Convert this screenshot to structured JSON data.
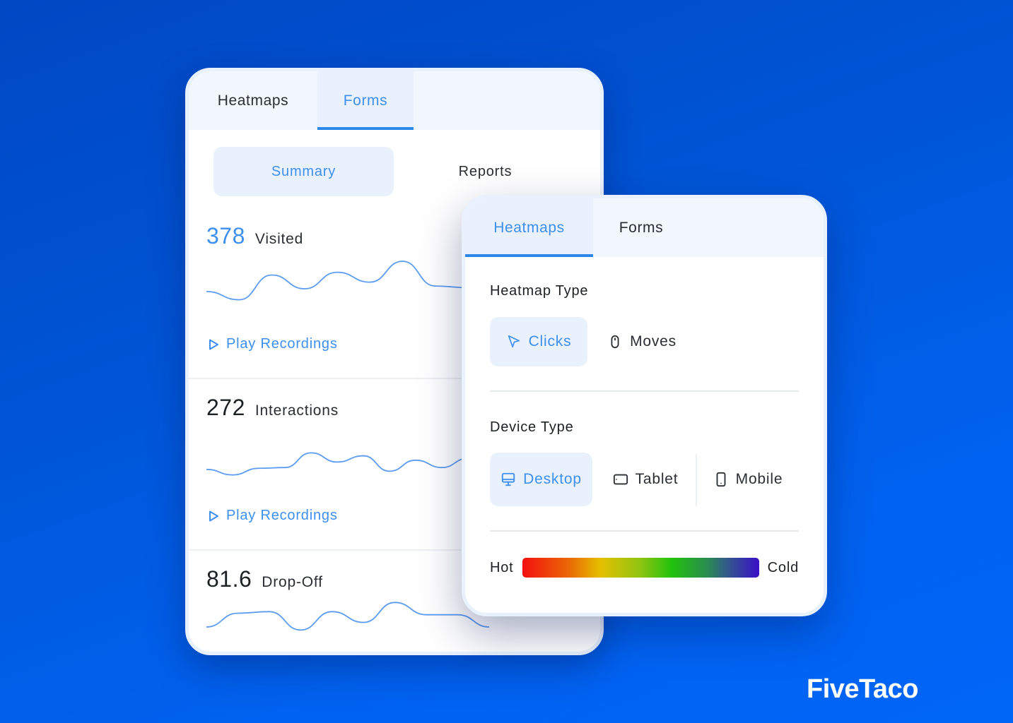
{
  "brand": {
    "logo_text": "FiveTaco"
  },
  "forms_panel": {
    "tabs": [
      {
        "label": "Heatmaps",
        "active": false
      },
      {
        "label": "Forms",
        "active": true
      }
    ],
    "segments": [
      {
        "label": "Summary",
        "active": true
      },
      {
        "label": "Reports",
        "active": false
      }
    ],
    "metrics": [
      {
        "value": "378",
        "label": "Visited",
        "accent": true,
        "action": "Play Recordings",
        "sparkline": [
          0.45,
          0.3,
          0.75,
          0.5,
          0.8,
          0.62,
          1.0,
          0.55,
          0.52
        ]
      },
      {
        "value": "272",
        "label": "Interactions",
        "accent": false,
        "action": "Play Recordings",
        "sparkline": [
          0.35,
          0.2,
          0.38,
          0.4,
          0.8,
          0.55,
          0.72,
          0.3,
          0.6,
          0.4,
          0.65
        ]
      },
      {
        "value": "81.6",
        "label": "Drop-Off",
        "accent": false,
        "action": "",
        "sparkline": [
          0.2,
          0.65,
          0.7,
          0.1,
          0.7,
          0.35,
          1.0,
          0.6,
          0.6,
          0.2
        ]
      }
    ]
  },
  "heatmap_panel": {
    "tabs": [
      {
        "label": "Heatmaps",
        "active": true
      },
      {
        "label": "Forms",
        "active": false
      }
    ],
    "heatmap_type": {
      "label": "Heatmap Type",
      "options": [
        {
          "label": "Clicks",
          "icon": "cursor-icon",
          "active": true
        },
        {
          "label": "Moves",
          "icon": "mouse-icon",
          "active": false
        }
      ]
    },
    "device_type": {
      "label": "Device Type",
      "options": [
        {
          "label": "Desktop",
          "icon": "desktop-icon",
          "active": true
        },
        {
          "label": "Tablet",
          "icon": "tablet-icon",
          "active": false
        },
        {
          "label": "Mobile",
          "icon": "mobile-icon",
          "active": false
        }
      ]
    },
    "legend": {
      "hot_label": "Hot",
      "cold_label": "Cold",
      "colors": [
        "#f41010",
        "#ea6a05",
        "#e5c000",
        "#8ec410",
        "#22c30b",
        "#2a8c50",
        "#325c8a",
        "#3a10c8"
      ]
    }
  },
  "colors": {
    "accent": "#3d8ff0",
    "tab_underline": "#2d86ea",
    "active_bg": "#e9f1fd",
    "background": "#0055d6"
  }
}
